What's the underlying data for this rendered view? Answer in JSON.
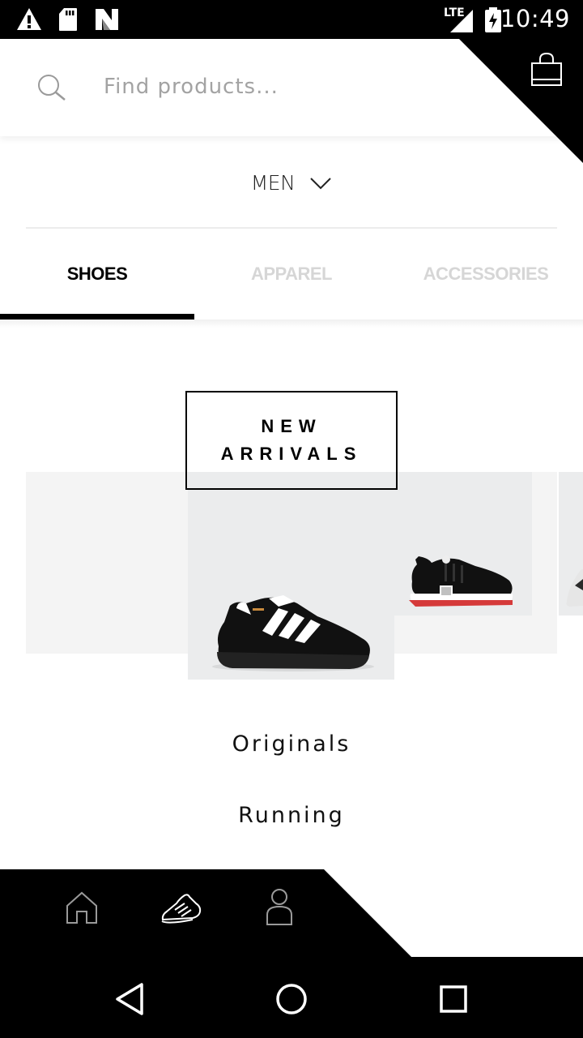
{
  "status_bar": {
    "time": "10:49",
    "network": "LTE",
    "icons": [
      "warning-icon",
      "sd-card-icon",
      "n-logo-icon",
      "signal-icon",
      "battery-charging-icon"
    ]
  },
  "search": {
    "placeholder": "Find products..."
  },
  "header": {
    "cart_icon": "shopping-bag-icon"
  },
  "gender_selector": {
    "label": "MEN"
  },
  "tabs": [
    {
      "label": "SHOES",
      "active": true
    },
    {
      "label": "APPAREL",
      "active": false
    },
    {
      "label": "ACCESSORIES",
      "active": false
    }
  ],
  "featured": {
    "title_line1": "NEW",
    "title_line2": "ARRIVALS"
  },
  "categories": [
    "Originals",
    "Running"
  ],
  "bottom_nav": {
    "items": [
      "home-icon",
      "shoe-icon",
      "profile-icon"
    ],
    "active": "shoe-icon"
  },
  "system_nav": [
    "back-icon",
    "home-circle-icon",
    "recents-icon"
  ],
  "colors": {
    "accent": "#000000",
    "inactive_tab": "#d6d6d6",
    "card_bg": "#ebeced",
    "carousel_bg": "#f4f4f4"
  }
}
